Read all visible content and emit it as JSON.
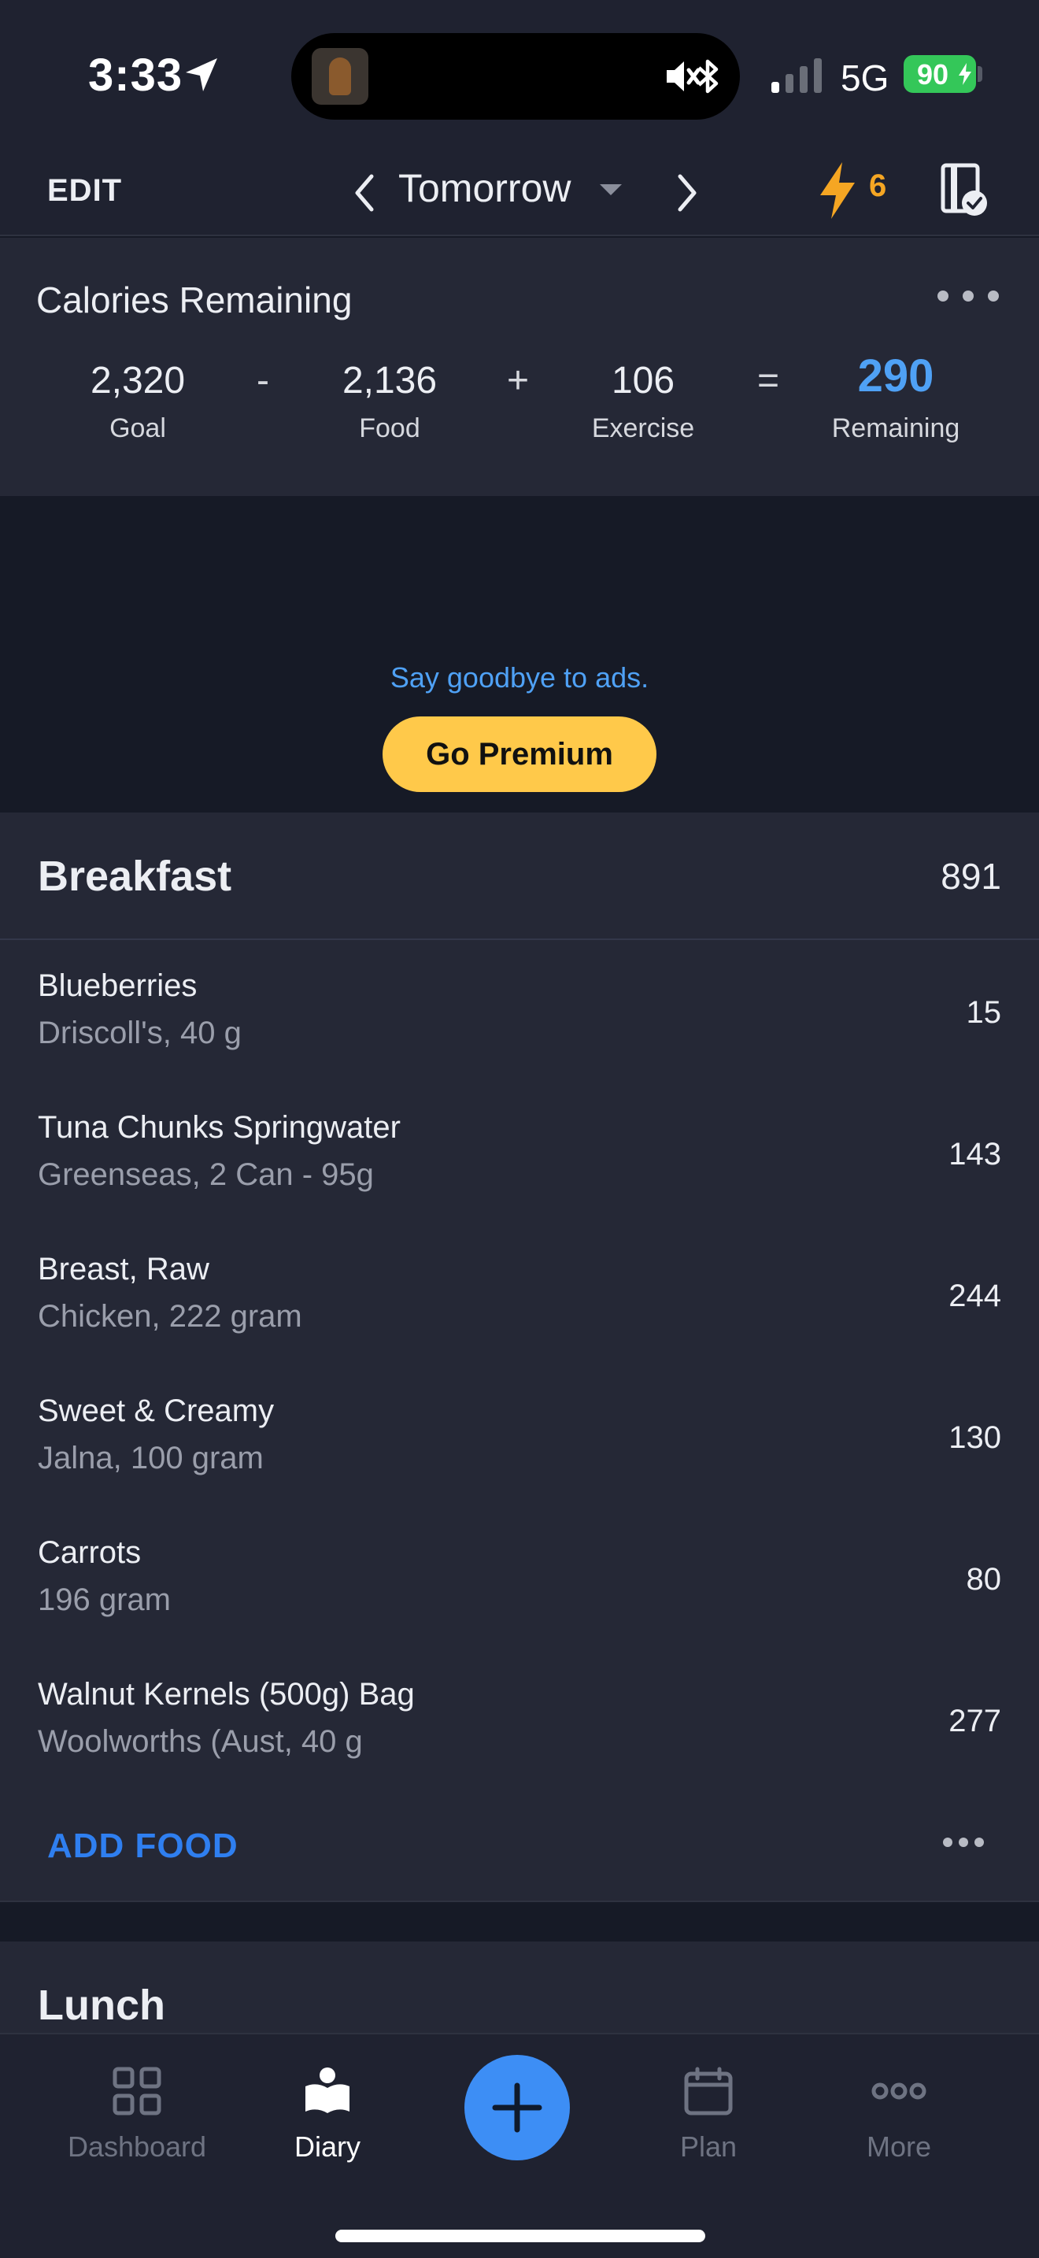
{
  "status_bar": {
    "time": "3:33",
    "network": "5G",
    "battery": "90"
  },
  "header": {
    "edit_label": "EDIT",
    "date_label": "Tomorrow",
    "streak_count": "6"
  },
  "calories": {
    "title": "Calories Remaining",
    "goal_value": "2,320",
    "goal_label": "Goal",
    "op_minus": "-",
    "food_value": "2,136",
    "food_label": "Food",
    "op_plus": "+",
    "exercise_value": "106",
    "exercise_label": "Exercise",
    "op_equals": "=",
    "remaining_value": "290",
    "remaining_label": "Remaining"
  },
  "ad": {
    "text": "Say goodbye to ads.",
    "button_label": "Go Premium"
  },
  "breakfast": {
    "name": "Breakfast",
    "total": "891",
    "items": [
      {
        "name": "Blueberries",
        "detail": "Driscoll's, 40 g",
        "calories": "15"
      },
      {
        "name": "Tuna Chunks Springwater",
        "detail": "Greenseas, 2 Can - 95g",
        "calories": "143"
      },
      {
        "name": "Breast, Raw",
        "detail": "Chicken, 222 gram",
        "calories": "244"
      },
      {
        "name": "Sweet & Creamy",
        "detail": "Jalna, 100 gram",
        "calories": "130"
      },
      {
        "name": "Carrots",
        "detail": "196 gram",
        "calories": "80"
      },
      {
        "name": "Walnut Kernels (500g) Bag",
        "detail": "Woolworths (Aust, 40 g",
        "calories": "277"
      }
    ],
    "add_food_label": "ADD FOOD"
  },
  "lunch": {
    "name": "Lunch"
  },
  "tab_bar": {
    "dashboard": "Dashboard",
    "diary": "Diary",
    "plan": "Plan",
    "more": "More"
  },
  "colors": {
    "accent": "#3d8ef5",
    "remaining": "#4fa1f5",
    "premium": "#ffc94a",
    "streak": "#f5a623",
    "battery": "#34c759"
  }
}
